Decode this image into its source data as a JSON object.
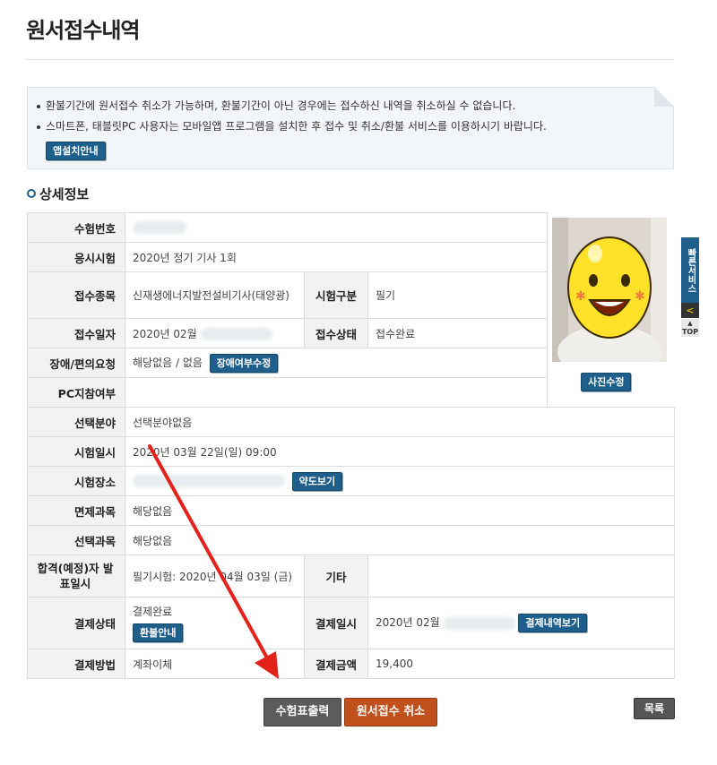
{
  "page": {
    "title": "원서접수내역"
  },
  "notice": {
    "items": [
      "환불기간에 원서접수 취소가 가능하며, 환불기간이 아닌 경우에는 접수하신 내역을 취소하실 수 없습니다.",
      "스마트폰, 태블릿PC 사용자는 모바일앱 프로그램을 설치한 후 접수 및 취소/환불 서비스를 이용하시기 바랍니다."
    ],
    "install_button": "앱설치안내"
  },
  "section": {
    "title": "상세정보"
  },
  "labels": {
    "exam_no": "수험번호",
    "exam": "응시시험",
    "field": "접수종목",
    "exam_type": "시험구분",
    "reg_date": "접수일자",
    "reg_status": "접수상태",
    "disability": "장애/편의요청",
    "pc_attend": "PC지참여부",
    "selected_field": "선택분야",
    "exam_datetime": "시험일시",
    "exam_place": "시험장소",
    "exempt": "면제과목",
    "selected_subject": "선택과목",
    "result_date": "합격(예정)자 발표일시",
    "etc": "기타",
    "pay_status": "결제상태",
    "pay_date": "결제일시",
    "pay_method": "결제방법",
    "pay_amount": "결제금액"
  },
  "values": {
    "exam": "2020년 정기 기사 1회",
    "field": "신재생에너지발전설비기사(태양광)",
    "exam_type": "필기",
    "reg_date": "2020년 02월",
    "reg_status": "접수완료",
    "disability": "해당없음 / 없음",
    "selected_field": "선택분야없음",
    "exam_datetime": "2020년 03월 22일(일) 09:00",
    "exempt": "해당없음",
    "selected_subject": "해당없음",
    "result_date": "필기시험: 2020년 04월 03일 (금)",
    "pay_status": "결제완료",
    "pay_date": "2020년 02월",
    "pay_method": "계좌이체",
    "pay_amount": "19,400"
  },
  "buttons": {
    "disability_edit": "장애여부수정",
    "photo_edit": "사진수정",
    "map": "약도보기",
    "refund_info": "환불안내",
    "pay_history": "결제내역보기",
    "print_ticket": "수험표출력",
    "cancel_application": "원서접수 취소",
    "list": "목록"
  },
  "side": {
    "quick_service": "빠른서비스",
    "collapse": "<",
    "top": "TOP"
  },
  "colors": {
    "accent": "#1f5f8b",
    "cancel": "#c0501c",
    "arrow": "#e3231b"
  }
}
